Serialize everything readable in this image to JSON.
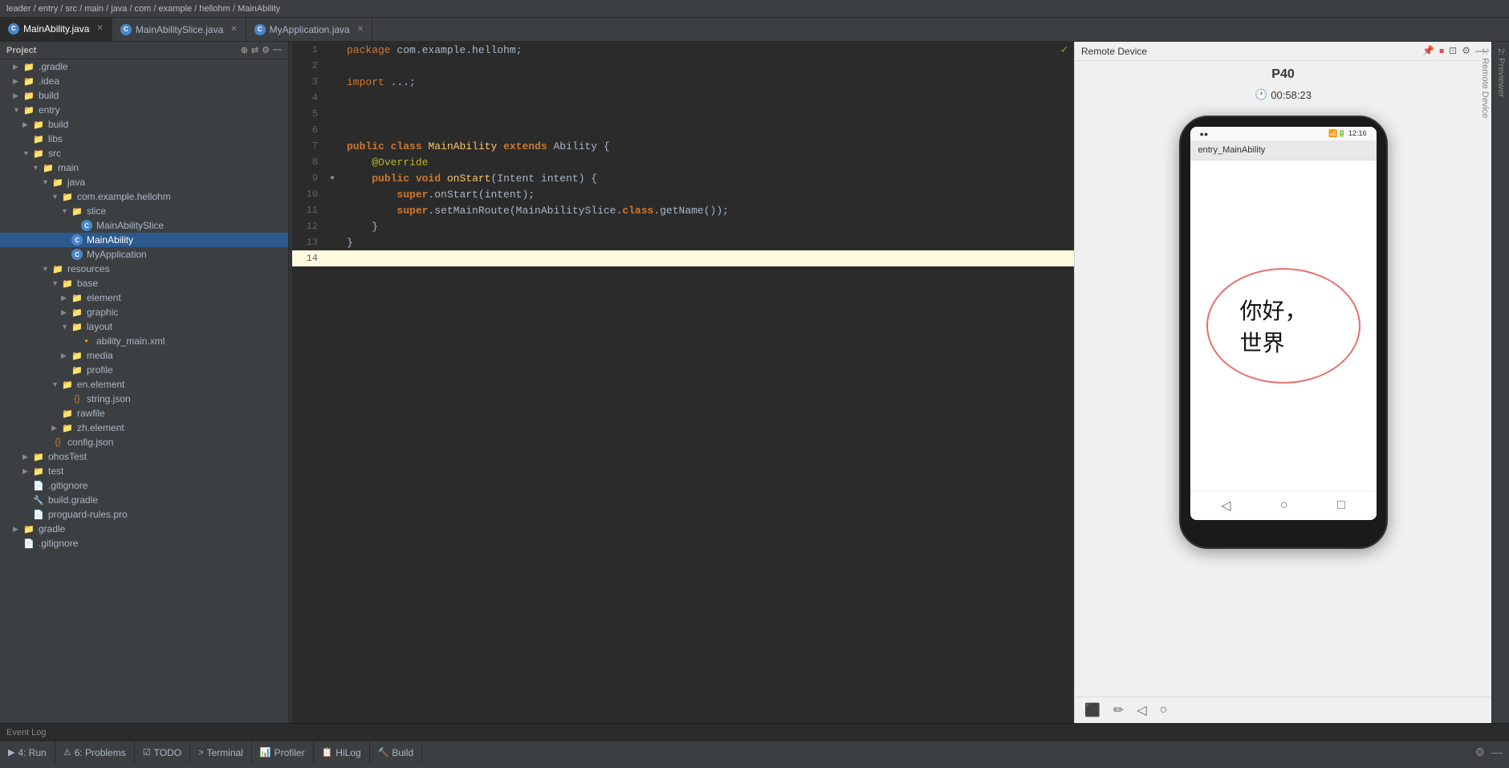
{
  "topbar": {
    "breadcrumb": "leader / entry / src / main / java / com / example / hellohm / MainAbility"
  },
  "tabs": [
    {
      "id": "tab1",
      "label": "MainAbility.java",
      "active": true,
      "icon": "C"
    },
    {
      "id": "tab2",
      "label": "MainAbilitySlice.java",
      "active": false,
      "icon": "C"
    },
    {
      "id": "tab3",
      "label": "MyApplication.java",
      "active": false,
      "icon": "C"
    }
  ],
  "sidebar": {
    "title": "Project",
    "tree": [
      {
        "indent": 1,
        "label": ".gradle",
        "type": "folder",
        "arrow": "▶",
        "id": "gradle-folder"
      },
      {
        "indent": 1,
        "label": ".idea",
        "type": "folder",
        "arrow": "▶",
        "id": "idea-folder"
      },
      {
        "indent": 1,
        "label": "build",
        "type": "folder",
        "arrow": "▶",
        "id": "build-folder"
      },
      {
        "indent": 1,
        "label": "entry",
        "type": "folder-blue",
        "arrow": "▼",
        "id": "entry-folder",
        "selected": false
      },
      {
        "indent": 2,
        "label": "build",
        "type": "folder",
        "arrow": "▶",
        "id": "entry-build-folder"
      },
      {
        "indent": 2,
        "label": "libs",
        "type": "folder",
        "arrow": "",
        "id": "libs-folder"
      },
      {
        "indent": 2,
        "label": "src",
        "type": "folder",
        "arrow": "▼",
        "id": "src-folder"
      },
      {
        "indent": 3,
        "label": "main",
        "type": "folder",
        "arrow": "▼",
        "id": "main-folder"
      },
      {
        "indent": 4,
        "label": "java",
        "type": "folder",
        "arrow": "▼",
        "id": "java-folder"
      },
      {
        "indent": 5,
        "label": "com.example.hellohm",
        "type": "folder",
        "arrow": "▼",
        "id": "com-folder"
      },
      {
        "indent": 6,
        "label": "slice",
        "type": "folder",
        "arrow": "▼",
        "id": "slice-folder"
      },
      {
        "indent": 7,
        "label": "MainAbilitySlice",
        "type": "java",
        "arrow": "",
        "id": "mainabilityslice-file"
      },
      {
        "indent": 6,
        "label": "MainAbility",
        "type": "java",
        "arrow": "",
        "id": "mainability-file",
        "selected": true
      },
      {
        "indent": 6,
        "label": "MyApplication",
        "type": "java",
        "arrow": "",
        "id": "myapplication-file"
      },
      {
        "indent": 4,
        "label": "resources",
        "type": "folder",
        "arrow": "▼",
        "id": "resources-folder"
      },
      {
        "indent": 5,
        "label": "base",
        "type": "folder",
        "arrow": "▼",
        "id": "base-folder"
      },
      {
        "indent": 6,
        "label": "element",
        "type": "folder",
        "arrow": "▶",
        "id": "element-folder"
      },
      {
        "indent": 6,
        "label": "graphic",
        "type": "folder",
        "arrow": "▶",
        "id": "graphic-folder"
      },
      {
        "indent": 6,
        "label": "layout",
        "type": "folder",
        "arrow": "▼",
        "id": "layout-folder"
      },
      {
        "indent": 7,
        "label": "ability_main.xml",
        "type": "xml",
        "arrow": "",
        "id": "ability-main-xml"
      },
      {
        "indent": 6,
        "label": "media",
        "type": "folder",
        "arrow": "▶",
        "id": "media-folder"
      },
      {
        "indent": 6,
        "label": "profile",
        "type": "folder",
        "arrow": "",
        "id": "profile-folder"
      },
      {
        "indent": 5,
        "label": "en.element",
        "type": "folder",
        "arrow": "▼",
        "id": "en-element-folder"
      },
      {
        "indent": 6,
        "label": "string.json",
        "type": "json",
        "arrow": "",
        "id": "string-json"
      },
      {
        "indent": 5,
        "label": "rawfile",
        "type": "folder",
        "arrow": "",
        "id": "rawfile-folder"
      },
      {
        "indent": 5,
        "label": "zh.element",
        "type": "folder",
        "arrow": "▶",
        "id": "zh-element-folder"
      },
      {
        "indent": 4,
        "label": "config.json",
        "type": "json",
        "arrow": "",
        "id": "config-json"
      },
      {
        "indent": 2,
        "label": "ohosTest",
        "type": "folder",
        "arrow": "▶",
        "id": "ohostest-folder"
      },
      {
        "indent": 2,
        "label": "test",
        "type": "folder",
        "arrow": "▶",
        "id": "test-folder"
      },
      {
        "indent": 2,
        "label": ".gitignore",
        "type": "file",
        "arrow": "",
        "id": "gitignore-file"
      },
      {
        "indent": 2,
        "label": "build.gradle",
        "type": "gradle",
        "arrow": "",
        "id": "build-gradle"
      },
      {
        "indent": 2,
        "label": "proguard-rules.pro",
        "type": "file",
        "arrow": "",
        "id": "proguard-file"
      },
      {
        "indent": 1,
        "label": "gradle",
        "type": "folder",
        "arrow": "▶",
        "id": "gradle2-folder"
      },
      {
        "indent": 1,
        "label": ".gitignore",
        "type": "file",
        "arrow": "",
        "id": "gitignore2-file"
      }
    ]
  },
  "editor": {
    "filename": "MainAbility.java",
    "lines": [
      {
        "num": 1,
        "code": "package com.example.hellohm;",
        "highlight": false
      },
      {
        "num": 2,
        "code": "",
        "highlight": false
      },
      {
        "num": 3,
        "code": "import ...;",
        "highlight": false
      },
      {
        "num": 4,
        "code": "",
        "highlight": false
      },
      {
        "num": 5,
        "code": "",
        "highlight": false
      },
      {
        "num": 6,
        "code": "",
        "highlight": false
      },
      {
        "num": 7,
        "code": "public class MainAbility extends Ability {",
        "highlight": false
      },
      {
        "num": 8,
        "code": "    @Override",
        "highlight": false
      },
      {
        "num": 9,
        "code": "    public void onStart(Intent intent) {",
        "highlight": false
      },
      {
        "num": 10,
        "code": "        super.onStart(intent);",
        "highlight": false
      },
      {
        "num": 11,
        "code": "        super.setMainRoute(MainAbilitySlice.class.getName());",
        "highlight": false
      },
      {
        "num": 12,
        "code": "    }",
        "highlight": false
      },
      {
        "num": 13,
        "code": "}",
        "highlight": false
      },
      {
        "num": 14,
        "code": "",
        "highlight": true
      }
    ]
  },
  "remote_panel": {
    "title": "Remote Device",
    "device_name": "P40",
    "timer": "00:58:23",
    "screen_title": "entry_MainAbility",
    "hello_world": "你好，世界",
    "bottom_toolbar": {
      "icons": [
        "screenshot",
        "draw",
        "back",
        "home"
      ]
    }
  },
  "bottom_tabs": [
    {
      "label": "4: Run",
      "icon": "▶"
    },
    {
      "label": "6: Problems",
      "badge": "",
      "icon": "⚠"
    },
    {
      "label": "TODO",
      "icon": "☑"
    },
    {
      "label": "Terminal",
      "icon": ">"
    },
    {
      "label": "Profiler",
      "icon": "📊"
    },
    {
      "label": "HiLog",
      "icon": "📋"
    },
    {
      "label": "Build",
      "icon": "🔨"
    }
  ],
  "event_log_label": "Event Log",
  "right_strip": [
    {
      "label": "2: Previewer"
    },
    {
      "label": "3: Remote Device"
    }
  ]
}
